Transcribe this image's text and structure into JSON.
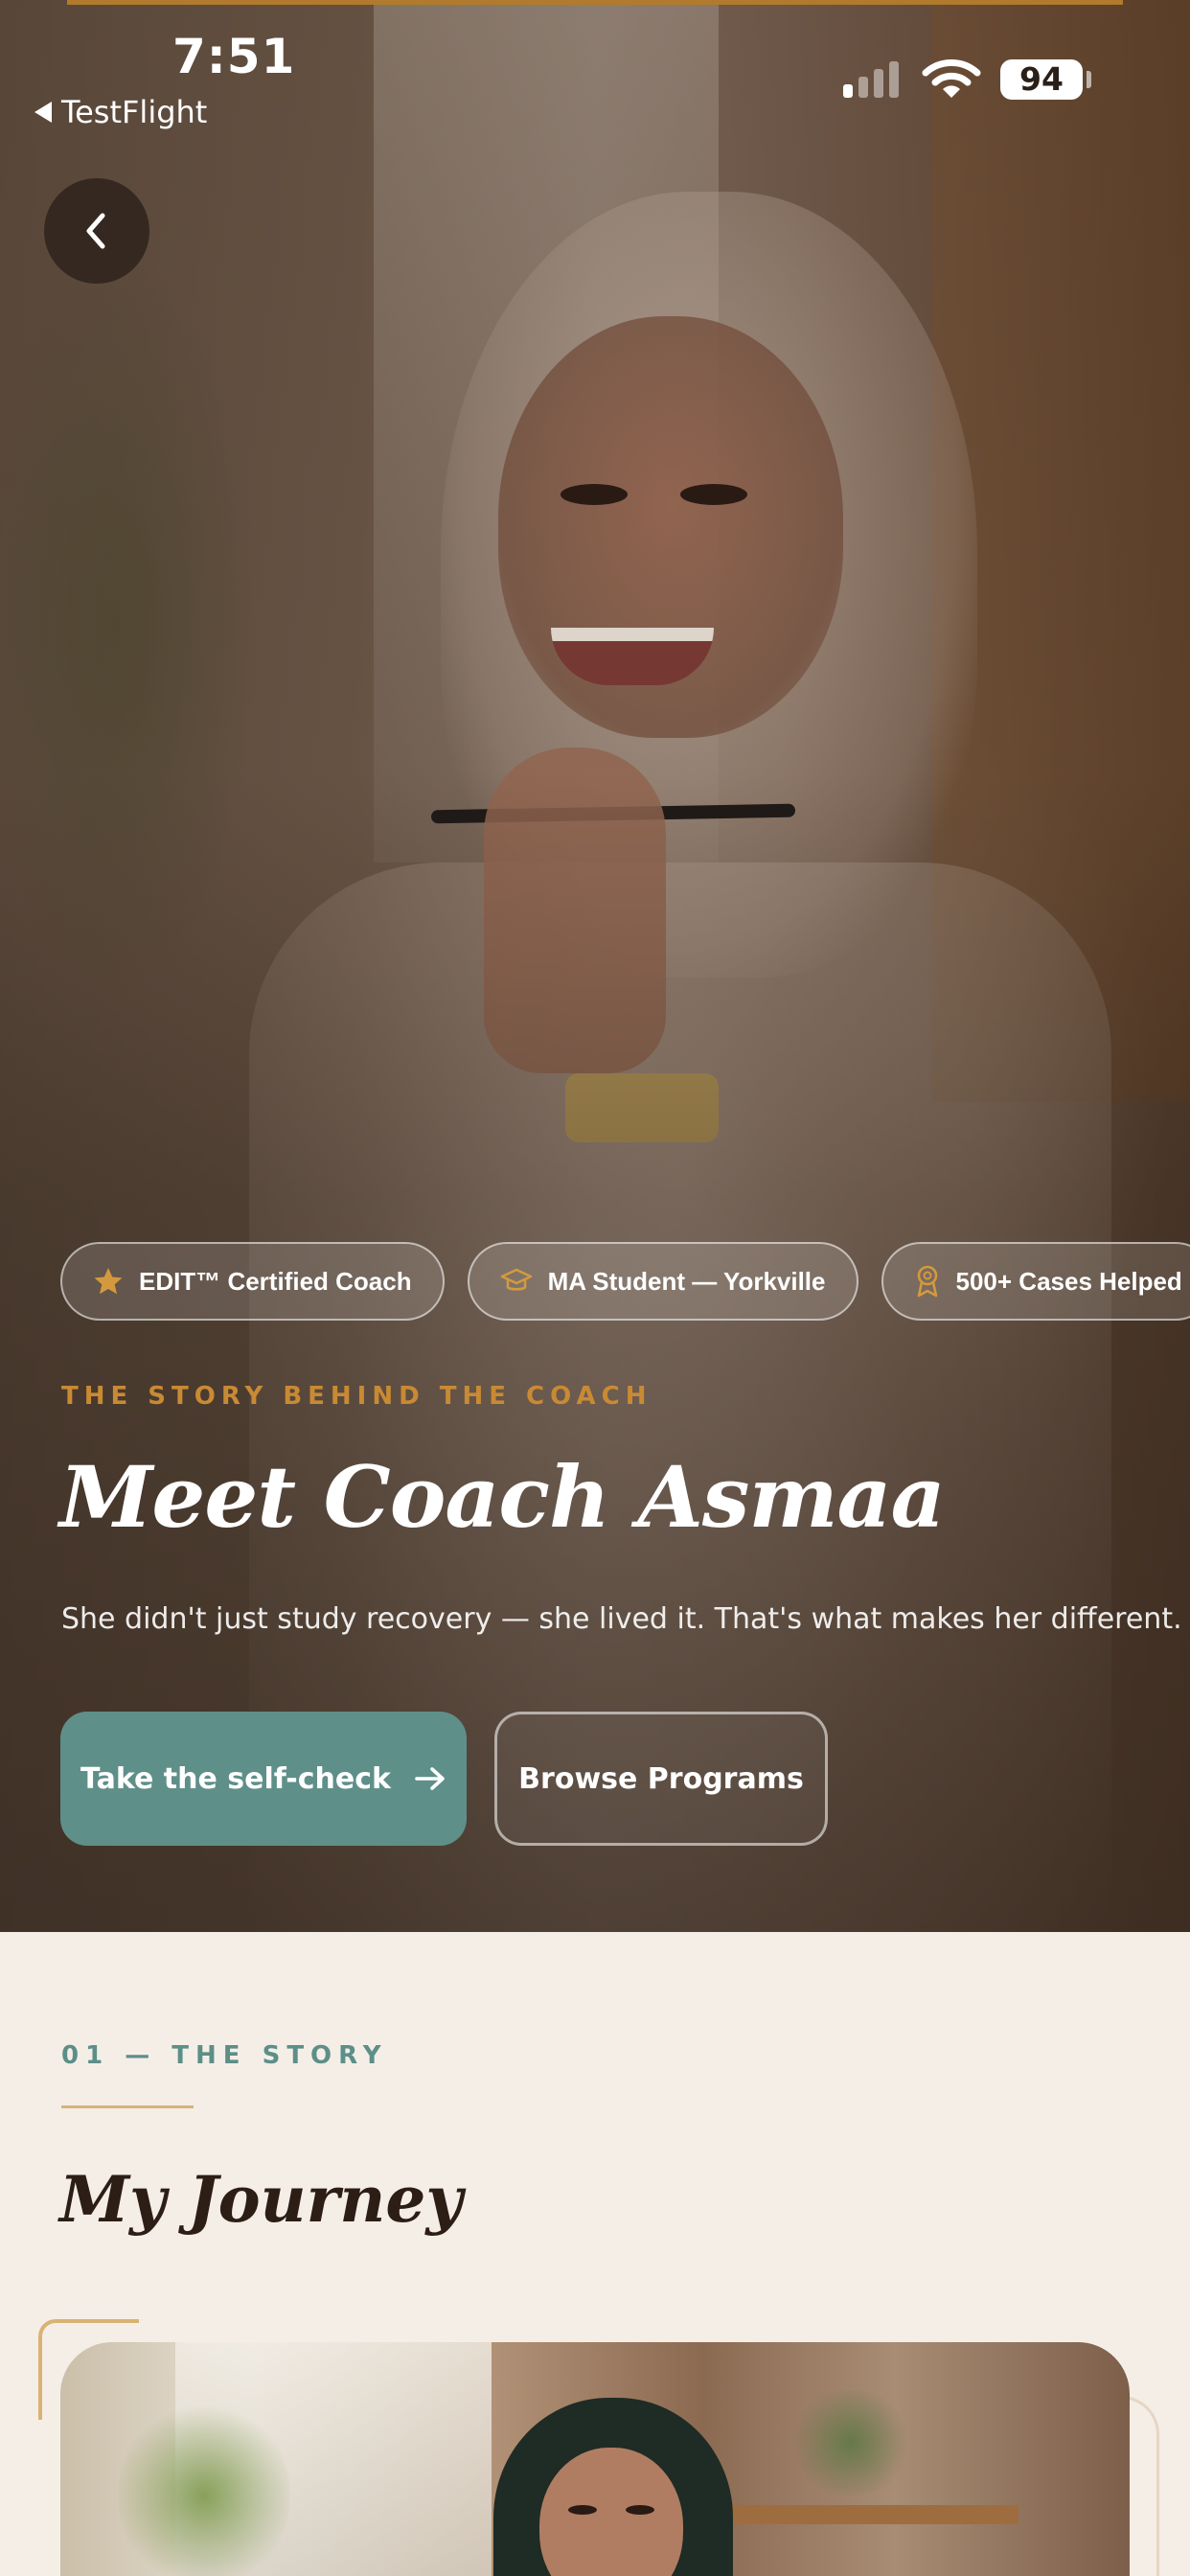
{
  "status_bar": {
    "time": "7:51",
    "back_app": "TestFlight",
    "battery": "94"
  },
  "hero": {
    "badges": [
      {
        "icon": "star-icon",
        "label": "EDIT™ Certified Coach"
      },
      {
        "icon": "graduation-cap-icon",
        "label": "MA Student — Yorkville"
      },
      {
        "icon": "award-ribbon-icon",
        "label": "500+ Cases Helped"
      }
    ],
    "eyebrow": "THE STORY BEHIND THE COACH",
    "title": "Meet Coach Asmaa",
    "subtitle": "She didn't just study recovery — she lived it. That's what makes her different.",
    "primary_button": "Take the self-check",
    "secondary_button": "Browse Programs"
  },
  "story": {
    "section_label": "01 — THE STORY",
    "title": "My Journey"
  },
  "colors": {
    "accent_gold": "#c98a34",
    "teal": "#5f8f89",
    "background": "#f5eee7",
    "heading_dark": "#2c1d15"
  }
}
